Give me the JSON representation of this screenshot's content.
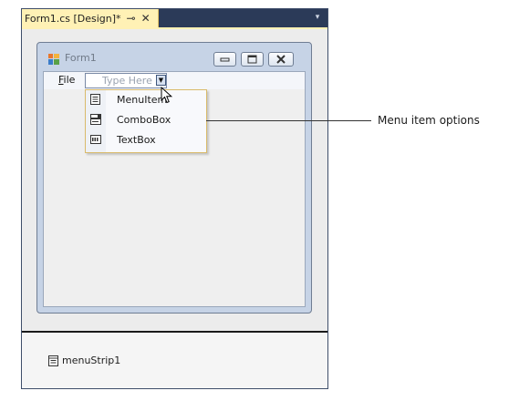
{
  "tab": {
    "title": "Form1.cs [Design]*",
    "pin_glyph": "⊸",
    "close_glyph": "✕",
    "dropdown_glyph": "▾"
  },
  "form": {
    "title": "Form1"
  },
  "menu_strip": {
    "file_accel": "F",
    "file_rest": "ile",
    "type_here_placeholder": "Type Here",
    "type_here_arrow": "▼"
  },
  "dropdown": {
    "items": [
      {
        "label": "MenuItem",
        "icon": "menu-item-icon"
      },
      {
        "label": "ComboBox",
        "icon": "combobox-icon"
      },
      {
        "label": "TextBox",
        "icon": "textbox-icon"
      }
    ]
  },
  "component_tray": {
    "items": [
      {
        "label": "menuStrip1",
        "icon": "menustrip-icon"
      }
    ]
  },
  "callout": {
    "label": "Menu item options"
  },
  "colors": {
    "tab_active": "#fff1b5",
    "ide_chrome": "#2b3a58",
    "dropdown_border": "#d9ba6a",
    "form_border": "#c6d3e6"
  }
}
